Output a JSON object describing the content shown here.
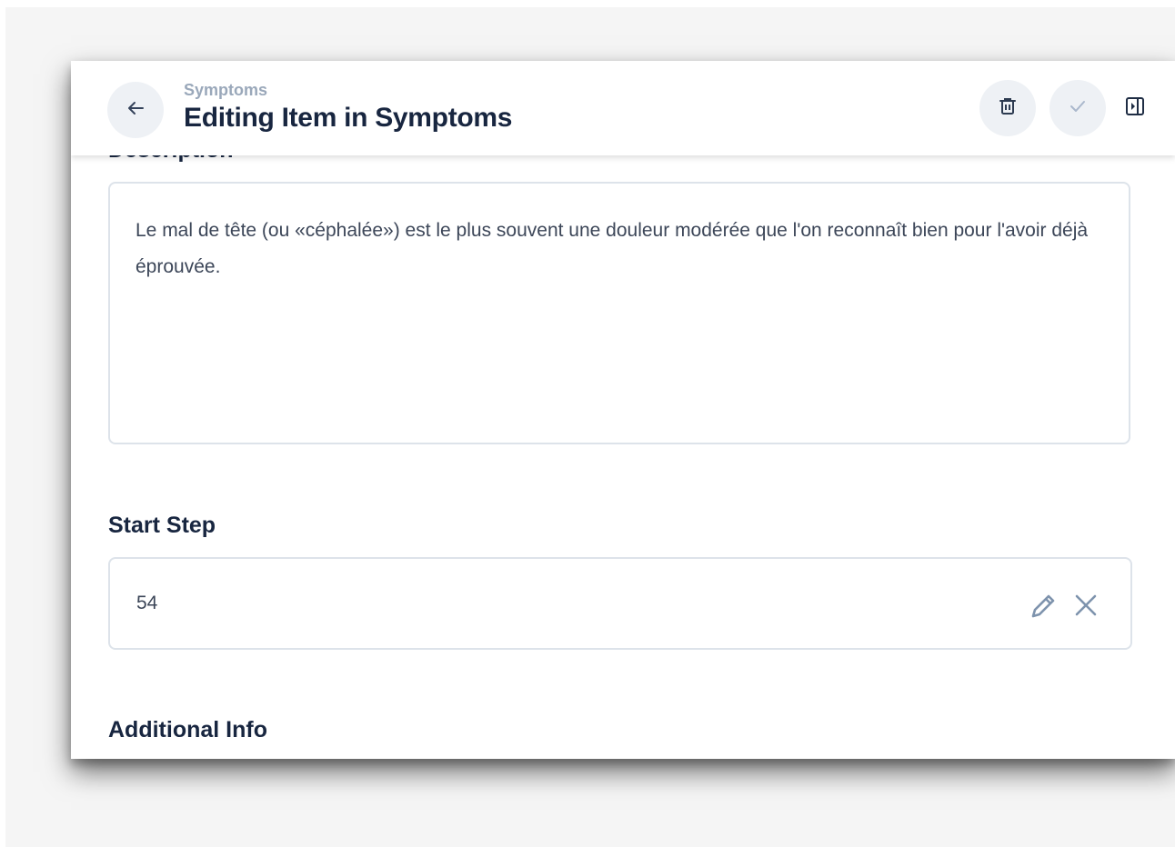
{
  "header": {
    "breadcrumb": "Symptoms",
    "title": "Editing Item in Symptoms",
    "back_icon": "arrow-left-icon",
    "delete_icon": "trash-icon",
    "save_icon": "check-icon",
    "panel_icon": "sidebar-collapse-icon"
  },
  "form": {
    "description_label": "Description",
    "description_value": "Le mal de tête (ou «céphalée») est le plus souvent une douleur modérée que l'on reconnaît bien pour l'avoir déjà éprouvée.",
    "start_step_label": "Start Step",
    "start_step_value": "54",
    "start_step_edit_icon": "pencil-icon",
    "start_step_clear_icon": "close-icon",
    "additional_info_label": "Additional Info"
  },
  "colors": {
    "title": "#182640",
    "breadcrumb": "#9aa8ba",
    "body_text": "#3c4658",
    "border": "#dde3ea",
    "button_bg": "#eef1f5",
    "icon": "#7e93ad"
  }
}
